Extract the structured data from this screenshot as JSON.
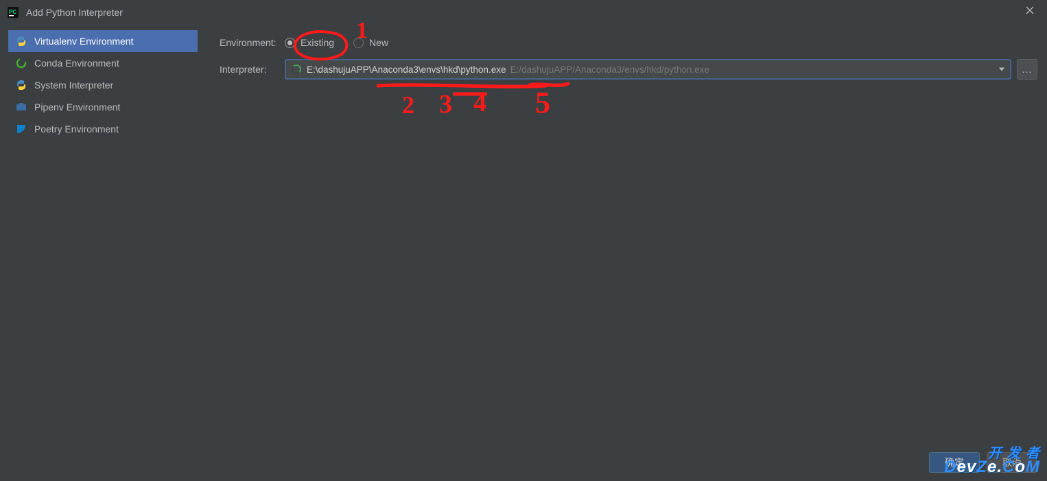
{
  "window": {
    "title": "Add Python Interpreter"
  },
  "sidebar": {
    "items": [
      {
        "label": "Virtualenv Environment"
      },
      {
        "label": "Conda Environment"
      },
      {
        "label": "System Interpreter"
      },
      {
        "label": "Pipenv Environment"
      },
      {
        "label": "Poetry Environment"
      }
    ]
  },
  "form": {
    "environment_label": "Environment:",
    "interpreter_label": "Interpreter:",
    "radio_existing": "Existing",
    "radio_new": "New",
    "interpreter_value": "E:\\dashujuAPP\\Anaconda3\\envs\\hkd\\python.exe",
    "interpreter_placeholder": "E:/dashujuAPP/Anaconda3/envs/hkd/python.exe",
    "browse_label": "..."
  },
  "buttons": {
    "ok": "确定",
    "cancel": "取消"
  },
  "annotations": {
    "n1": "1",
    "n2": "2",
    "n3": "3",
    "n4": "4",
    "n5": "5"
  },
  "watermark": {
    "line1": "开 发 者",
    "line2_a": "D",
    "line2_b": "ev",
    "line2_c": "Z",
    "line2_d": "e.",
    "line2_e": "C",
    "line2_f": "o",
    "line2_g": "M"
  }
}
